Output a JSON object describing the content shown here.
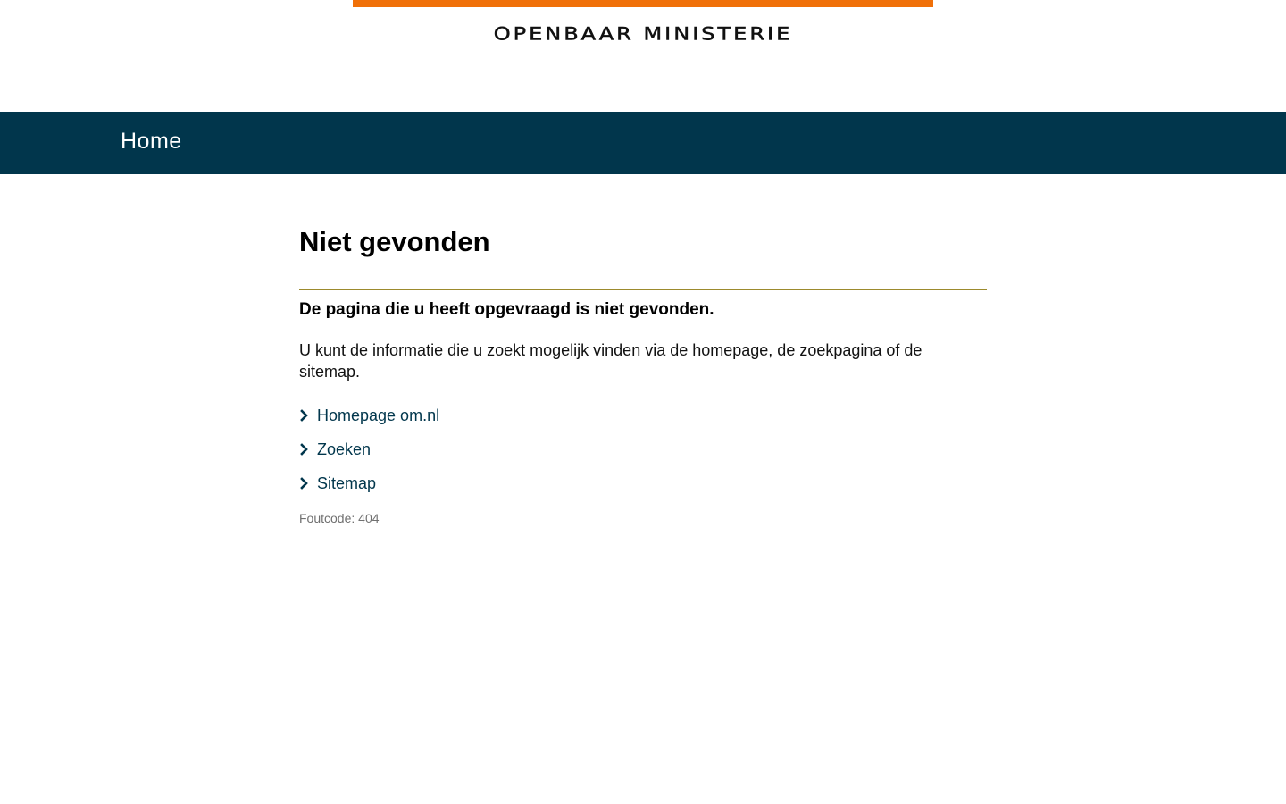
{
  "colors": {
    "accent_orange": "#f07008",
    "nav_background": "#01364c",
    "divider": "#9c8a2d",
    "link": "#01364c"
  },
  "header": {
    "logo_text": "OPENBAAR MINISTERIE"
  },
  "nav": {
    "home_label": "Home"
  },
  "main": {
    "title": "Niet gevonden",
    "lead": "De pagina die u heeft opgevraagd is niet gevonden.",
    "info": "U kunt de informatie die u zoekt mogelijk vinden via de homepage, de zoekpagina of de sitemap.",
    "links": [
      {
        "label": "Homepage om.nl",
        "icon": "chevron-right-icon"
      },
      {
        "label": "Zoeken",
        "icon": "chevron-right-icon"
      },
      {
        "label": "Sitemap",
        "icon": "chevron-right-icon"
      }
    ],
    "error_code": "Foutcode: 404"
  }
}
